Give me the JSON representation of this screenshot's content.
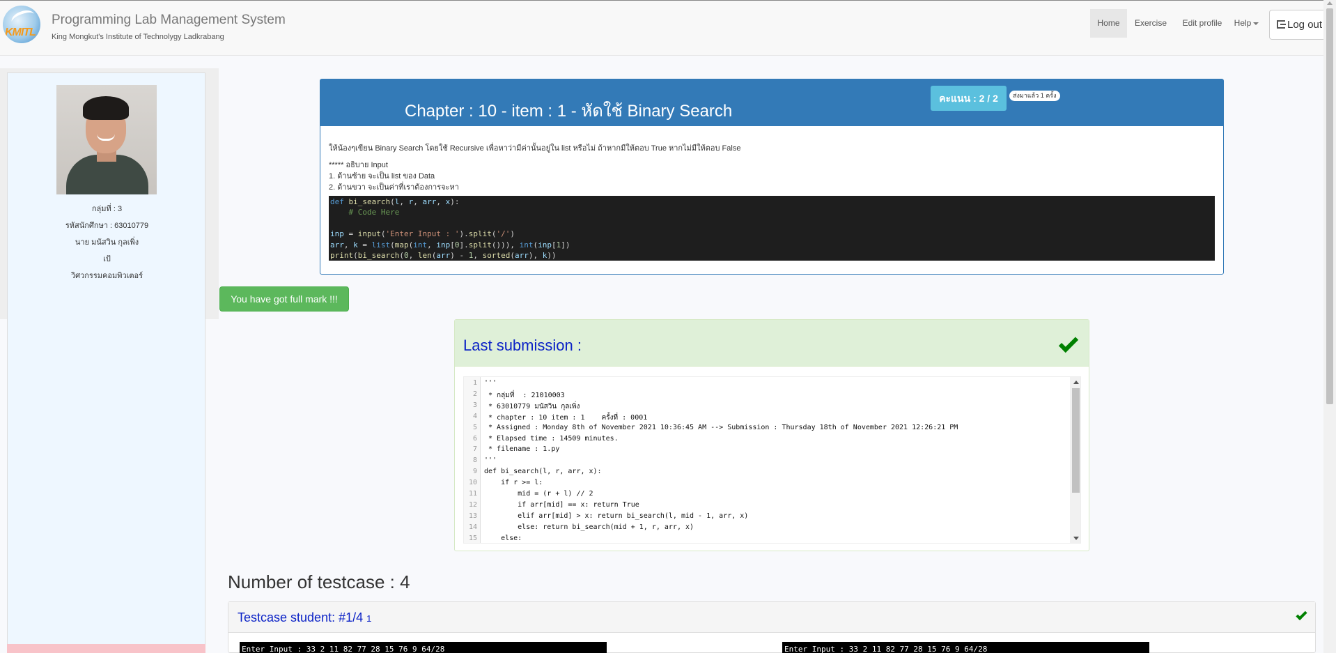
{
  "navbar": {
    "logo_text": "KMITL",
    "title": "Programming Lab Management System",
    "subtitle": "King Mongkut's Institute of Technolygy Ladkrabang",
    "items": [
      {
        "label": "Home"
      },
      {
        "label": "Exercise"
      },
      {
        "label": "Edit profile"
      },
      {
        "label": "Help"
      }
    ],
    "logout_label": "Log out"
  },
  "profile": {
    "group": "กลุ่มที่ : 3",
    "student_id": "รหัสนักศึกษา : 63010779",
    "name": "นาย มนัสวิน กุลเพิ่ง",
    "nickname": "เป้",
    "department": "วิศวกรรมคอมพิวเตอร์"
  },
  "chapter": {
    "title": "Chapter : 10 - item : 1 - หัดใช้ Binary Search",
    "score": "คะแนน : 2 / 2",
    "sent_badge": "ส่งมาแล้ว 1 ครั้ง",
    "description": "ให้น้องๆเขียน Binary Search โดยใช้ Recursive เพื่อหาว่ามีค่านั้นอยู่ใน list หรือไม่ ถ้าหากมีให้ตอบ True หากไม่มีให้ตอบ False",
    "input_heading": "***** อธิบาย Input",
    "input_line1": "1. ด้านซ้าย  จะเป็น list ของ Data",
    "input_line2": "2. ด้านขวา  จะเป็นค่าที่เราต้องการจะหา",
    "code_lines": [
      "def bi_search(l, r, arr, x):",
      "    # Code Here",
      "",
      "inp = input('Enter Input : ').split('/')",
      "arr, k = list(map(int, inp[0].split())), int(inp[1])",
      "print(bi_search(0, len(arr) - 1, sorted(arr), k))"
    ]
  },
  "full_mark_label": "You have got full mark !!!",
  "submission": {
    "title": "Last submission :",
    "lines": [
      "'''",
      " * กลุ่มที่  : 21010003",
      " * 63010779 มนัสวิน กุลเพิ่ง",
      " * chapter : 10 item : 1    ครั้งที่ : 0001",
      " * Assigned : Monday 8th of November 2021 10:36:45 AM --> Submission : Thursday 18th of November 2021 12:26:21 PM",
      " * Elapsed time : 14509 minutes.",
      " * filename : 1.py",
      "'''",
      "def bi_search(l, r, arr, x):",
      "    if r >= l:",
      "        mid = (r + l) // 2",
      "        if arr[mid] == x: return True",
      "        elif arr[mid] > x: return bi_search(l, mid - 1, arr, x)",
      "        else: return bi_search(mid + 1, r, arr, x)",
      "    else:"
    ],
    "line_numbers": [
      "1",
      "2",
      "3",
      "4",
      "5",
      "6",
      "7",
      "8",
      "9",
      "10",
      "11",
      "12",
      "13",
      "14",
      "15"
    ]
  },
  "testcase": {
    "count_label": "Number of testcase : 4",
    "title": "Testcase student: #1/4",
    "small": "1",
    "input_left": "Enter Input : 33 2 11 82 77 28 15 76 9 64/28",
    "input_right": "Enter Input : 33 2 11 82 77 28 15 76 9 64/28"
  },
  "colors": {
    "primary": "#337ab7",
    "success": "#5cb85c",
    "info": "#5bc0de",
    "link_blue": "#0b22c6",
    "check_green": "#008000"
  },
  "icons": [
    "kmitl-logo-icon",
    "logout-icon",
    "caret-down-icon",
    "check-icon",
    "scroll-up-icon",
    "scroll-down-icon"
  ]
}
